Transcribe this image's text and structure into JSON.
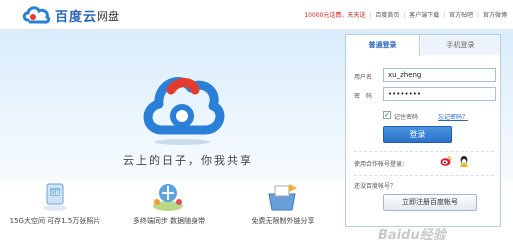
{
  "header": {
    "brand": "百度云",
    "brand_sub": "网盘",
    "promo": "10000元话费，天天送",
    "nav": [
      "百度首页",
      "客户端下载",
      "官方贴吧",
      "官方微博"
    ]
  },
  "banner": {
    "slogan": "云上的日子，你我共享"
  },
  "features": [
    {
      "icon": "storage-icon",
      "label": "15G大空间 可存1.5万张照片"
    },
    {
      "icon": "sync-icon",
      "label": "多终端同步 数据随身带"
    },
    {
      "icon": "share-icon",
      "label": "免费无限制外链分享"
    }
  ],
  "login": {
    "tab_active": "普通登录",
    "tab_inactive": "手机登录",
    "username_label": "用户名",
    "username_value": "xu_zheng",
    "password_label": "密　码",
    "password_value": "••••••••",
    "remember_label": "记住密码",
    "forgot_label": "忘记密码？",
    "login_button": "登录",
    "partner_label": "使用合作帐号登录：",
    "partners": [
      "weibo-icon",
      "qq-icon"
    ],
    "no_account": "还没百度帐号？",
    "register_button": "立即注册百度帐号"
  },
  "watermark": "Baidu经验",
  "colors": {
    "brand": "#2a64b8",
    "accent_red": "#d0211b",
    "cloud_red": "#e33b2e",
    "cloud_blue": "#2a7fd6"
  }
}
